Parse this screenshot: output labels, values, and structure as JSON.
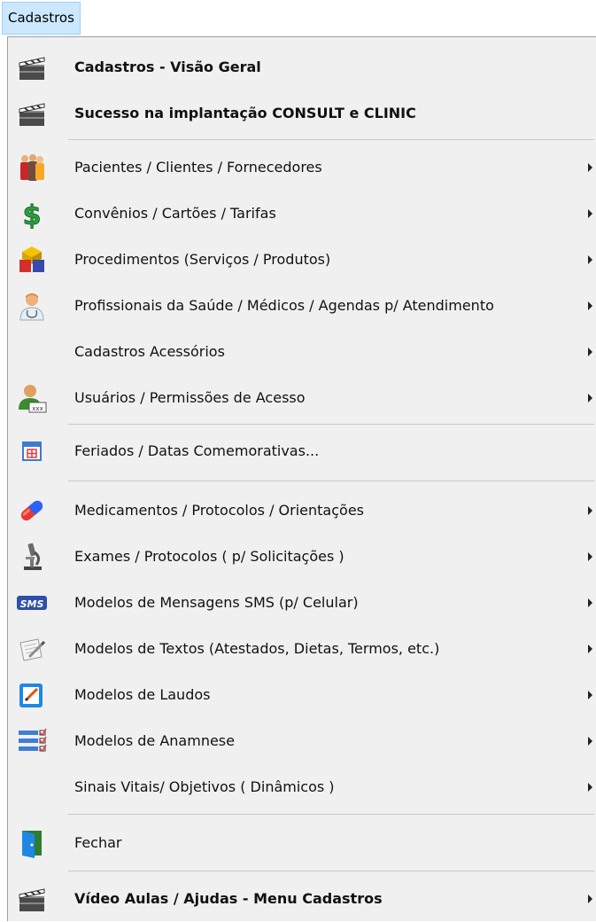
{
  "menubar": {
    "title": "Cadastros"
  },
  "menu": {
    "items": [
      {
        "label": "Cadastros  - Visão Geral",
        "icon": "clapperboard-icon"
      },
      {
        "label": "Sucesso na implantação CONSULT e CLINIC",
        "icon": "clapperboard-icon"
      },
      {
        "label": "Pacientes / Clientes / Fornecedores",
        "icon": "people-icon"
      },
      {
        "label": "Convênios / Cartões / Tarifas",
        "icon": "dollar-icon"
      },
      {
        "label": "Procedimentos (Serviços / Produtos)",
        "icon": "shapes-icon"
      },
      {
        "label": "Profissionais da Saúde / Médicos / Agendas p/ Atendimento",
        "icon": "doctor-icon"
      },
      {
        "label": "Cadastros Acessórios"
      },
      {
        "label": "Usuários / Permissões de Acesso",
        "icon": "user-password-icon"
      },
      {
        "label": "Feriados / Datas Comemorativas...",
        "icon": "calendar-icon"
      },
      {
        "label": "Medicamentos / Protocolos / Orientações",
        "icon": "pill-icon"
      },
      {
        "label": "Exames / Protocolos ( p/ Solicitações )",
        "icon": "microscope-icon"
      },
      {
        "label": "Modelos de Mensagens SMS (p/ Celular)",
        "icon": "sms-icon",
        "icon_text": "SMS"
      },
      {
        "label": "Modelos de Textos (Atestados, Dietas, Termos, etc.)",
        "icon": "document-pencil-icon"
      },
      {
        "label": "Modelos de Laudos",
        "icon": "edit-document-icon"
      },
      {
        "label": "Modelos de Anamnese",
        "icon": "checklist-icon"
      },
      {
        "label": "Sinais Vitais/ Objetivos ( Dinâmicos )"
      },
      {
        "label": "Fechar",
        "icon": "exit-door-icon"
      },
      {
        "label": "Vídeo Aulas / Ajudas - Menu Cadastros",
        "icon": "clapperboard-icon"
      }
    ]
  },
  "colors": {
    "menubar_highlight": "#cce8ff",
    "menu_background": "#f0f0f0",
    "separator": "#c8c8c8"
  }
}
